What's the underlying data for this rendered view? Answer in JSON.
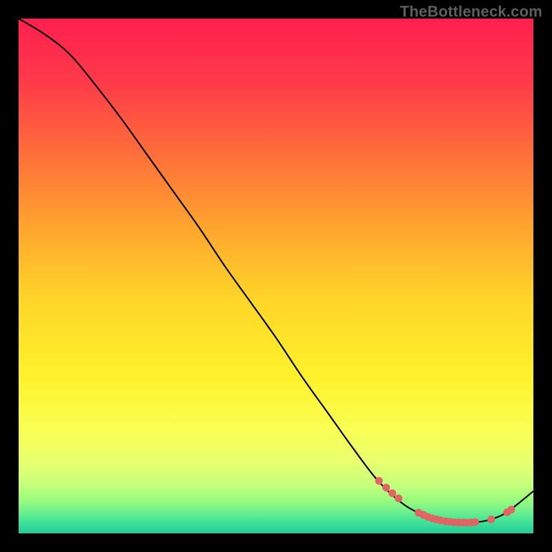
{
  "watermark": "TheBottleneck.com",
  "chart_data": {
    "type": "line",
    "title": "",
    "xlabel": "",
    "ylabel": "",
    "xlim": [
      0,
      100
    ],
    "ylim": [
      0,
      100
    ],
    "grid": false,
    "legend": false,
    "series": [
      {
        "name": "curve",
        "x": [
          0,
          5,
          10,
          15,
          20,
          25,
          30,
          35,
          40,
          45,
          50,
          55,
          60,
          65,
          70,
          75,
          80,
          82,
          85,
          88,
          90,
          92,
          95,
          100
        ],
        "y": [
          100,
          97,
          93,
          87,
          80.5,
          73.5,
          66.5,
          59.5,
          52,
          45,
          38,
          30.5,
          23.5,
          16.5,
          10,
          5.5,
          3,
          2.4,
          2.1,
          2.1,
          2.3,
          2.8,
          4.2,
          8.2
        ]
      }
    ],
    "markers": [
      {
        "x": 70.0,
        "y": 10.2
      },
      {
        "x": 71.4,
        "y": 8.9
      },
      {
        "x": 72.6,
        "y": 7.8
      },
      {
        "x": 73.8,
        "y": 6.8
      },
      {
        "x": 77.7,
        "y": 4.0
      },
      {
        "x": 78.6,
        "y": 3.6
      },
      {
        "x": 79.5,
        "y": 3.2
      },
      {
        "x": 80.4,
        "y": 2.9
      },
      {
        "x": 81.2,
        "y": 2.7
      },
      {
        "x": 82.0,
        "y": 2.5
      },
      {
        "x": 82.9,
        "y": 2.35
      },
      {
        "x": 83.8,
        "y": 2.25
      },
      {
        "x": 84.6,
        "y": 2.15
      },
      {
        "x": 85.5,
        "y": 2.1
      },
      {
        "x": 86.3,
        "y": 2.1
      },
      {
        "x": 87.0,
        "y": 2.1
      },
      {
        "x": 87.9,
        "y": 2.12
      },
      {
        "x": 88.7,
        "y": 2.2
      },
      {
        "x": 91.8,
        "y": 2.7
      },
      {
        "x": 94.9,
        "y": 4.1
      },
      {
        "x": 95.7,
        "y": 4.6
      }
    ],
    "gradient_stops": [
      {
        "offset": 0.0,
        "color": "#ff1f4e"
      },
      {
        "offset": 0.12,
        "color": "#ff394a"
      },
      {
        "offset": 0.25,
        "color": "#ff6a3b"
      },
      {
        "offset": 0.4,
        "color": "#ffa32f"
      },
      {
        "offset": 0.55,
        "color": "#ffd728"
      },
      {
        "offset": 0.7,
        "color": "#fff22c"
      },
      {
        "offset": 0.8,
        "color": "#f9ff54"
      },
      {
        "offset": 0.86,
        "color": "#e8ff6e"
      },
      {
        "offset": 0.905,
        "color": "#c6ff7c"
      },
      {
        "offset": 0.935,
        "color": "#9bfc7e"
      },
      {
        "offset": 0.958,
        "color": "#6ef08b"
      },
      {
        "offset": 0.975,
        "color": "#46e496"
      },
      {
        "offset": 0.99,
        "color": "#2fd69a"
      },
      {
        "offset": 1.0,
        "color": "#28c98f"
      }
    ],
    "marker_color": "#e06666",
    "curve_color": "#000000"
  }
}
